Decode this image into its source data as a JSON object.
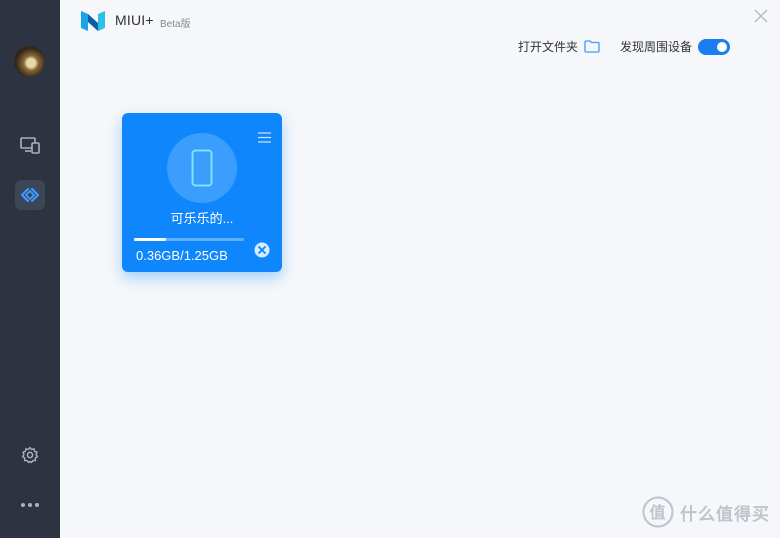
{
  "app": {
    "title": "MIUI+",
    "beta_label": "Beta版"
  },
  "header": {
    "open_folder_label": "打开文件夹",
    "discover_label": "发现周围设备",
    "discover_enabled": true
  },
  "sidebar": {
    "items": [
      {
        "name": "devices",
        "icon": "devices-icon"
      },
      {
        "name": "share",
        "icon": "share-icon",
        "active": true
      },
      {
        "name": "settings",
        "icon": "gear-icon"
      },
      {
        "name": "more",
        "icon": "more-icon"
      }
    ]
  },
  "device_card": {
    "name": "可乐乐的...",
    "size_text": "0.36GB/1.25GB",
    "progress": 0.29
  },
  "watermark": {
    "text": "什么值得买",
    "logo_char": "值"
  },
  "colors": {
    "accent": "#0f86fb",
    "sidebar": "#2d3340",
    "background": "#f5f7fa"
  }
}
